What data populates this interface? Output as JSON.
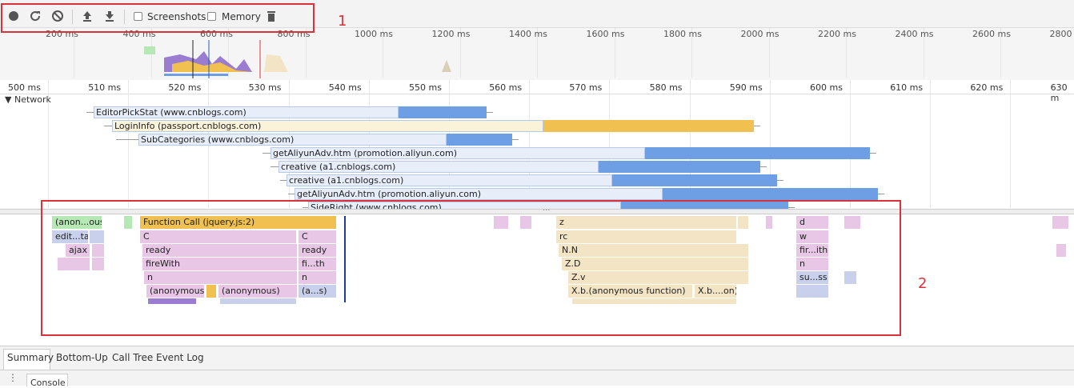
{
  "toolbar": {
    "screenshots_label": "Screenshots",
    "memory_label": "Memory"
  },
  "overview": {
    "ticks": [
      "200 ms",
      "400 ms",
      "600 ms",
      "800 ms",
      "1000 ms",
      "1200 ms",
      "1400 ms",
      "1600 ms",
      "1800 ms",
      "2000 ms",
      "2200 ms",
      "2400 ms",
      "2600 ms",
      "2800"
    ]
  },
  "ruler": {
    "ticks": [
      "500 ms",
      "510 ms",
      "520 ms",
      "530 ms",
      "540 ms",
      "550 ms",
      "560 ms",
      "570 ms",
      "580 ms",
      "590 ms",
      "600 ms",
      "610 ms",
      "620 ms",
      "630 m"
    ]
  },
  "network": {
    "label": "Network",
    "requests": [
      {
        "name": "EditorPickStat (www.cnblogs.com)"
      },
      {
        "name": "LoginInfo (passport.cnblogs.com)"
      },
      {
        "name": "SubCategories (www.cnblogs.com)"
      },
      {
        "name": "getAliyunAdv.htm (promotion.aliyun.com)"
      },
      {
        "name": "creative (a1.cnblogs.com)"
      },
      {
        "name": "creative (a1.cnblogs.com)"
      },
      {
        "name": "getAliyunAdv.htm (promotion.aliyun.com)"
      },
      {
        "name": "SideRight (www.cnblogs.com)"
      }
    ]
  },
  "flame": {
    "anon_ous": "(anon...ous)",
    "edit_tat": "edit...tat",
    "ajax": "ajax",
    "function_call": "Function Call (jquery.js:2)",
    "c1": "C",
    "c2": "C",
    "ready1": "ready",
    "ready2": "ready",
    "firewith1": "fireWith",
    "firewith2": "fi...th",
    "n1": "n",
    "n2": "n",
    "anonymous1": "(anonymous)",
    "anonymous2": "(anonymous)",
    "as": "(a...s)",
    "z": "z",
    "rc": "rc",
    "nn": "N.N",
    "zd": "Z.D",
    "zv": "Z.v",
    "xb_anon": "X.b.(anonymous function)",
    "xb_on": "X.b....on)",
    "d": "d",
    "w": "w",
    "fir_ith": "fir...ith",
    "n3": "n",
    "su_ss": "su...ss"
  },
  "annotations": {
    "one": "1",
    "two": "2"
  },
  "bottom_tabs": [
    "Summary",
    "Bottom-Up",
    "Call Tree",
    "Event Log"
  ],
  "drawer": {
    "console": "Console"
  },
  "colors": {
    "record_gray": "#555555",
    "annotation_red": "#d8333b",
    "network_blue": "#6e9fe4",
    "login_orange": "#f0c050"
  }
}
